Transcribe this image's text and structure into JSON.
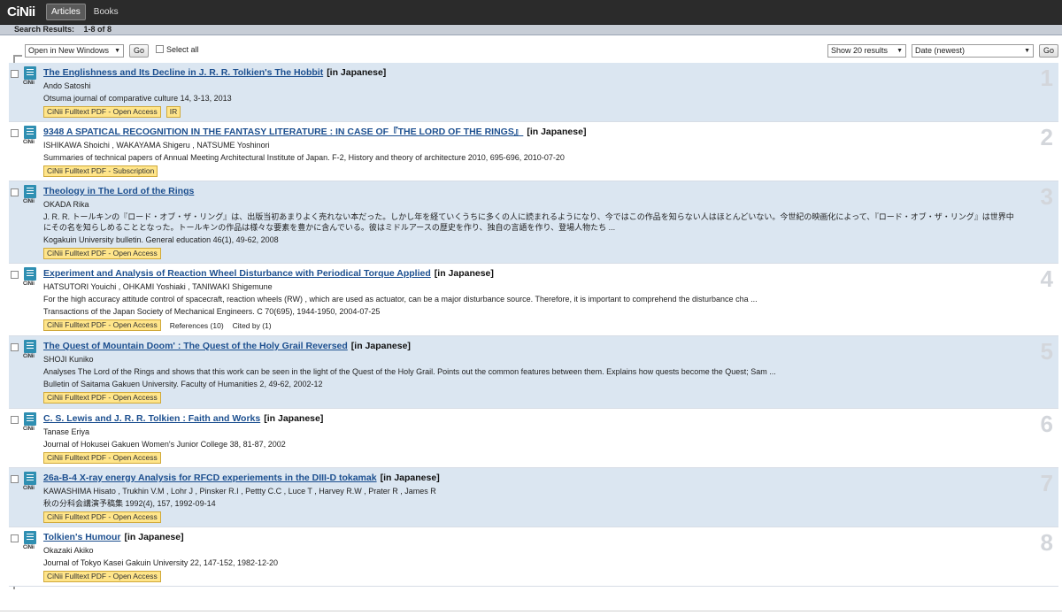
{
  "header": {
    "logo": "CiNii",
    "tabs": [
      {
        "label": "Articles",
        "active": true
      },
      {
        "label": "Books",
        "active": false
      }
    ]
  },
  "summary": {
    "label": "Search Results:",
    "range": "1-8 of 8"
  },
  "controls": {
    "open_in": "Open in New Windows",
    "go_label": "Go",
    "select_all": "Select all",
    "show_results": "Show 20 results",
    "sort": "Date (newest)",
    "go2_label": "Go"
  },
  "results": [
    {
      "index": "1",
      "title": "The Englishness and Its Decline in J. R. R. Tolkien's The Hobbit",
      "lang": "[in Japanese]",
      "authors": "Ando Satoshi",
      "abstract": "",
      "source": "Otsuma journal of comparative culture 14, 3-13, 2013",
      "badges": [
        "CiNii Fulltext PDF - Open Access",
        "IR"
      ],
      "extras": []
    },
    {
      "index": "2",
      "title": "9348 A SPATICAL RECOGNITION IN THE FANTASY LITERATURE : IN CASE OF『THE LORD OF THE RINGS』",
      "lang": "[in Japanese]",
      "authors": "ISHIKAWA Shoichi , WAKAYAMA Shigeru , NATSUME Yoshinori",
      "abstract": "",
      "source": "Summaries of technical papers of Annual Meeting Architectural Institute of Japan. F-2, History and theory of architecture 2010, 695-696, 2010-07-20",
      "badges": [
        "CiNii Fulltext PDF - Subscription"
      ],
      "extras": []
    },
    {
      "index": "3",
      "title": "Theology in The Lord of the Rings",
      "lang": "",
      "authors": "OKADA Rika",
      "abstract": "J. R. R. トールキンの『ロード・オブ・ザ・リング』は、出版当初あまりよく売れない本だった。しかし年を経ていくうちに多くの人に読まれるようになり、今ではこの作品を知らない人はほとんどいない。今世紀の映画化によって、『ロード・オブ・ザ・リング』は世界中にその名を知らしめることとなった。トールキンの作品は様々な要素を豊かに含んでいる。彼はミドルアースの歴史を作り、独自の言語を作り、登場人物たち ...",
      "source": "Kogakuin University bulletin. General education 46(1), 49-62, 2008",
      "badges": [
        "CiNii Fulltext PDF - Open Access"
      ],
      "extras": []
    },
    {
      "index": "4",
      "title": "Experiment and Analysis of Reaction Wheel Disturbance with Periodical Torque Applied",
      "lang": "[in Japanese]",
      "authors": "HATSUTORI Youichi , OHKAMI Yoshiaki , TANIWAKI Shigemune",
      "abstract": "For the high accuracy attitude control of spacecraft, reaction wheels (RW) , which are used as actuator, can be a major disturbance source. Therefore, it is important to comprehend the disturbance cha ...",
      "source": "Transactions of the Japan Society of Mechanical Engineers. C 70(695), 1944-1950, 2004-07-25",
      "badges": [
        "CiNii Fulltext PDF - Open Access"
      ],
      "extras": [
        "References (10)",
        "Cited by (1)"
      ]
    },
    {
      "index": "5",
      "title": "The Quest of Mountain Doom' : The Quest of the Holy Grail Reversed",
      "lang": "[in Japanese]",
      "authors": "SHOJI Kuniko",
      "abstract": "Analyses The Lord of the Rings and shows that this work can be seen in the light of the Quest of the Holy Grail. Points out the common features between them. Explains how quests become the Quest; Sam ...",
      "source": "Bulletin of Saitama Gakuen University. Faculty of Humanities 2, 49-62, 2002-12",
      "badges": [
        "CiNii Fulltext PDF - Open Access"
      ],
      "extras": []
    },
    {
      "index": "6",
      "title": "C. S. Lewis and J. R. R. Tolkien : Faith and Works",
      "lang": "[in Japanese]",
      "authors": "Tanase Eriya",
      "abstract": "",
      "source": "Journal of Hokusei Gakuen Women's Junior College 38, 81-87, 2002",
      "badges": [
        "CiNii Fulltext PDF - Open Access"
      ],
      "extras": []
    },
    {
      "index": "7",
      "title": "26a-B-4 X-ray energy Analysis for RFCD experiements in the DIII-D tokamak",
      "lang": "[in Japanese]",
      "authors": "KAWASHIMA Hisato , Trukhin V.M , Lohr J , Pinsker R.I , Pettty C.C , Luce T , Harvey R.W , Prater R , James R",
      "abstract": "",
      "source": "秋の分科会講演予稿集 1992(4), 157, 1992-09-14",
      "badges": [
        "CiNii Fulltext PDF - Open Access"
      ],
      "extras": []
    },
    {
      "index": "8",
      "title": "Tolkien's Humour",
      "lang": "[in Japanese]",
      "authors": "Okazaki Akiko",
      "abstract": "",
      "source": "Journal of Tokyo Kasei Gakuin University 22, 147-152, 1982-12-20",
      "badges": [
        "CiNii Fulltext PDF - Open Access"
      ],
      "extras": []
    }
  ]
}
